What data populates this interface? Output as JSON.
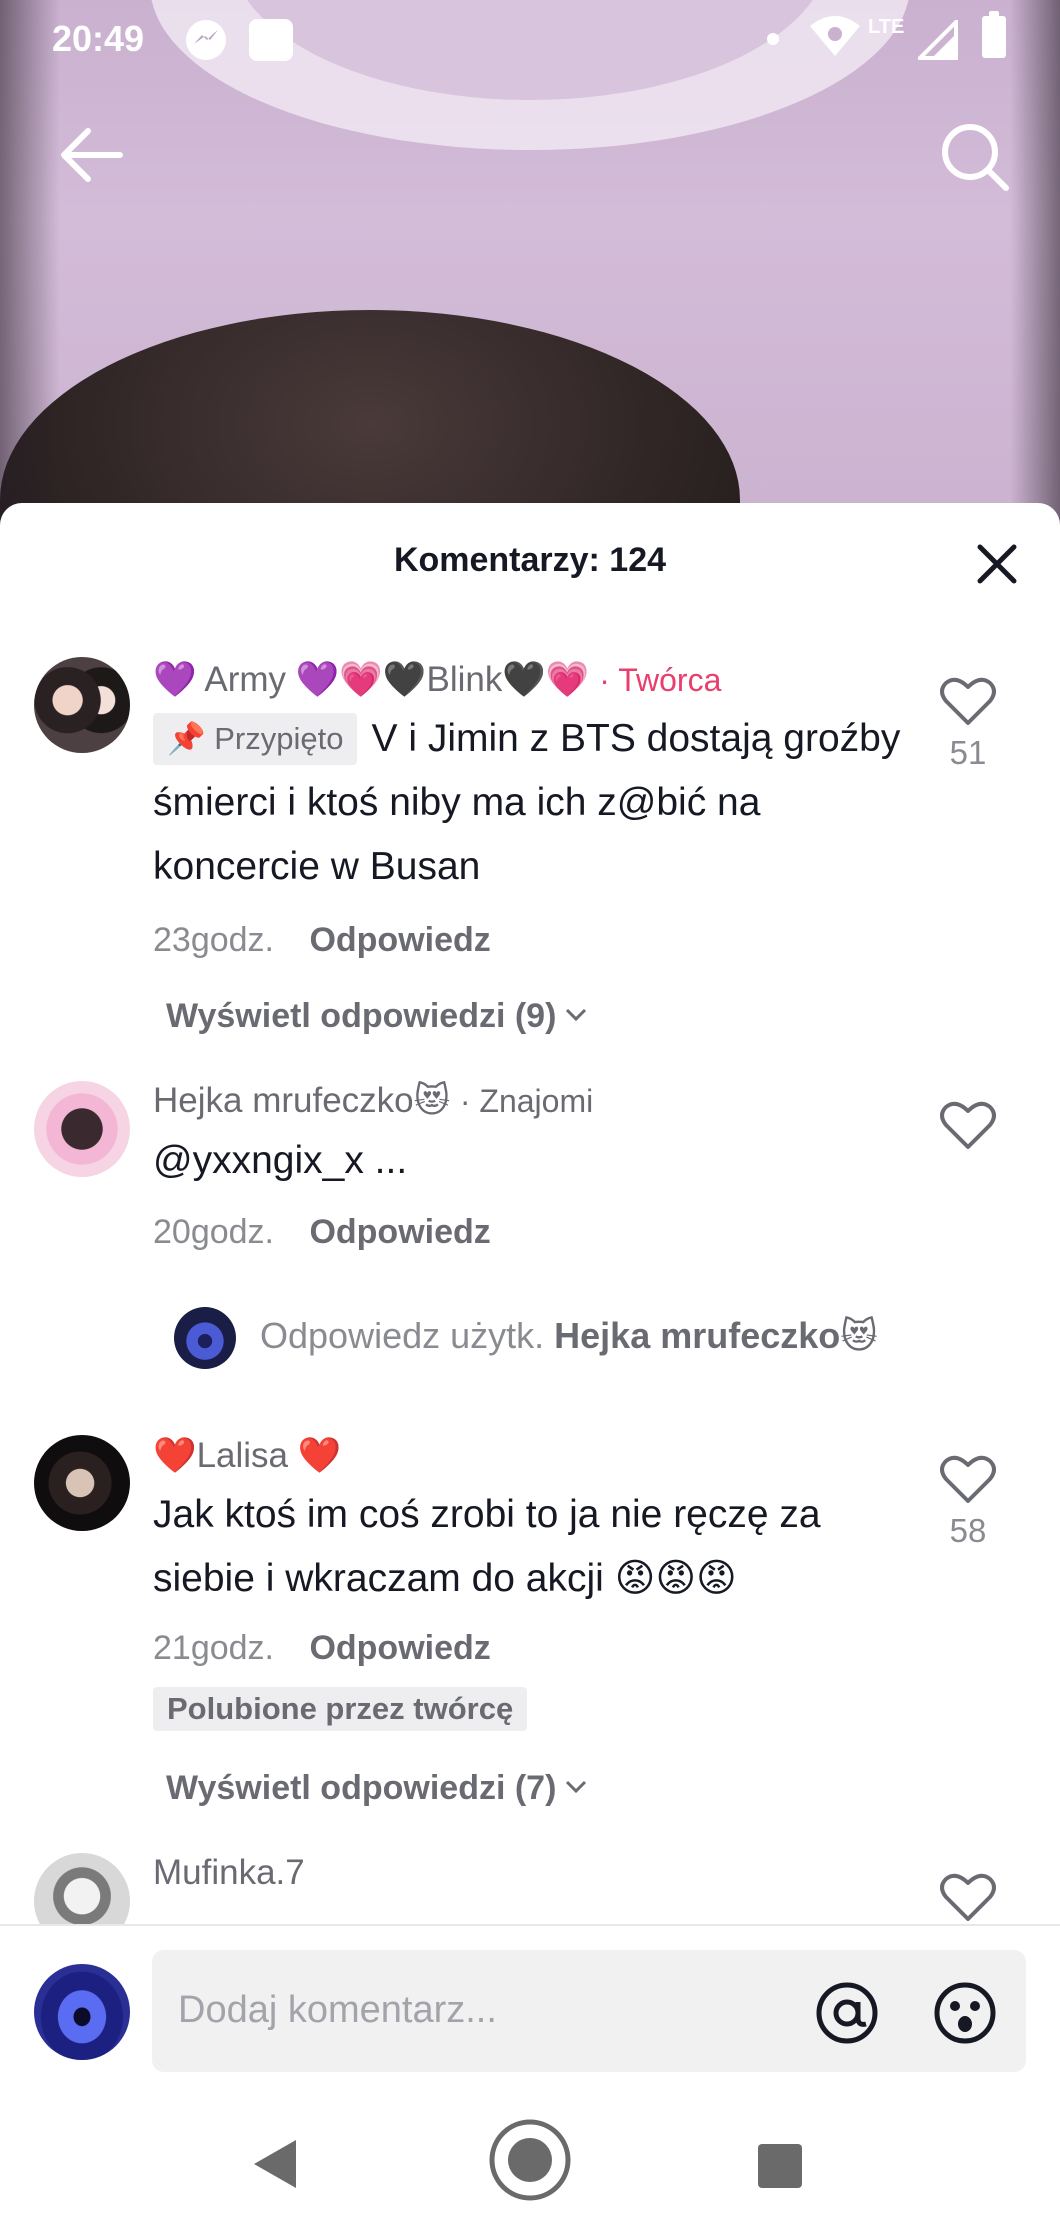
{
  "status_bar": {
    "time": "20:49",
    "network": "LTE"
  },
  "top_nav": {
    "back_icon": "arrow-left-icon",
    "search_icon": "search-icon"
  },
  "comments_sheet": {
    "title": "Komentarzy: 124",
    "close_icon": "close-icon",
    "comments": [
      {
        "username": "💜 Army 💜💗🖤Blink🖤💗",
        "badge": "· Twórca",
        "pinned_label": "Przypięto",
        "text": "V i Jimin z BTS dostają groźby śmierci i ktoś niby ma ich z@bić na koncercie w Busan",
        "time": "23godz.",
        "reply_label": "Odpowiedz",
        "likes": "51",
        "view_replies": "Wyświetl odpowiedzi (9)"
      },
      {
        "username": "Hejka mrufeczko😻",
        "badge": "· Znajomi",
        "text": "@yxxngix_x ...",
        "time": "20godz.",
        "reply_label": "Odpowiedz",
        "likes": ""
      },
      {
        "reply_prompt_prefix": "Odpowiedz użytk.",
        "reply_prompt_user": "Hejka mrufeczko😻"
      },
      {
        "username": "❤️Lalisa ❤️",
        "text": "Jak ktoś im coś zrobi to ja nie ręczę za siebie i wkraczam do akcji 😡😡😡",
        "time": "21godz.",
        "reply_label": "Odpowiedz",
        "liked_by": "Polubione przez twórcę",
        "likes": "58",
        "view_replies": "Wyświetl odpowiedzi (7)"
      },
      {
        "username": "Mufinka.7"
      }
    ]
  },
  "input_bar": {
    "placeholder": "Dodaj komentarz...",
    "mention_icon": "at-sign-icon",
    "emoji_icon": "emoji-face-icon"
  },
  "colors": {
    "creator_badge": "#e83f6f",
    "text_primary": "#161823",
    "text_secondary": "#6a6b72"
  }
}
